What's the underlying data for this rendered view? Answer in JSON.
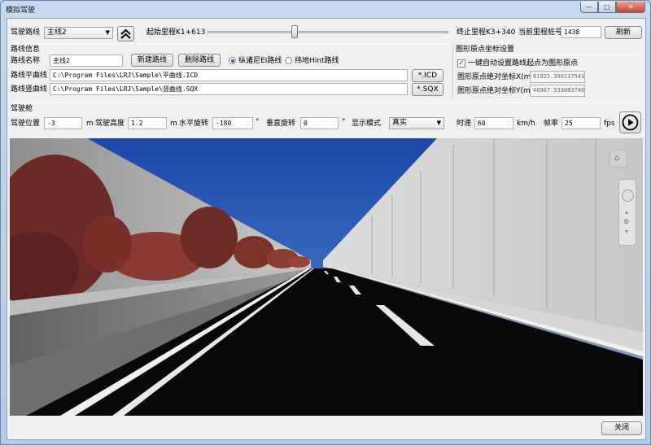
{
  "window": {
    "title": "模拟驾驶"
  },
  "toolbar": {
    "route_label": "驾驶路线",
    "route_value": "主线2",
    "start_mileage_label": "起始里程K1+613",
    "slider_fraction": 0.36,
    "end_mileage_label": "终止里程K3+340",
    "current_label": "当前里程桩号",
    "current_value": "1438",
    "refresh_label": "刷新"
  },
  "route_info": {
    "section_title": "路线信息",
    "name_label": "路线名称",
    "name_value": "主线2",
    "new_route_label": "新建路线",
    "delete_route_label": "删除路线",
    "radio_option_1": "纵诸尼EI路线",
    "radio_option_2": "纬地Hint路线",
    "horizontal_label": "路线平曲线",
    "horizontal_value": "C:\\Program Files\\LRJ\\Sample\\平曲线.ICD",
    "icd_button": "*.ICD",
    "vertical_label": "路线竖曲线",
    "vertical_value": "C:\\Program Files\\LRJ\\Sample\\竖曲线.SQX",
    "sqx_button": "*.SQX"
  },
  "origin": {
    "section_title": "图形原点坐标设置",
    "auto_label": "一键自动设置路线起点为图形原点",
    "x_label": "图形原点绝对坐标X(m)",
    "x_value": "61925.399117541",
    "y_label": "图形原点绝对坐标Y(m)",
    "y_value": "48967.533083740"
  },
  "cockpit": {
    "section_title": "驾驶舱",
    "position_label": "驾驶位置",
    "position_value": "-3",
    "position_unit": "m",
    "height_label": "驾驶高度",
    "height_value": "1.2",
    "height_unit": "m",
    "hrot_label": "水平旋转",
    "hrot_value": "-180",
    "hrot_unit": "°",
    "vrot_label": "垂直旋转",
    "vrot_value": "0",
    "vrot_unit": "°",
    "mode_label": "显示模式",
    "mode_value": "真实",
    "speed_label": "时速",
    "speed_value": "60",
    "speed_unit": "km/h",
    "fps_label": "帧率",
    "fps_value": "25",
    "fps_unit": "fps"
  },
  "footer": {
    "close_label": "关闭"
  },
  "colors": {
    "sky_top": "#1a47a8",
    "sky_bottom": "#a9c5e6",
    "road": "#080808",
    "accent": "#2a5bb0"
  }
}
